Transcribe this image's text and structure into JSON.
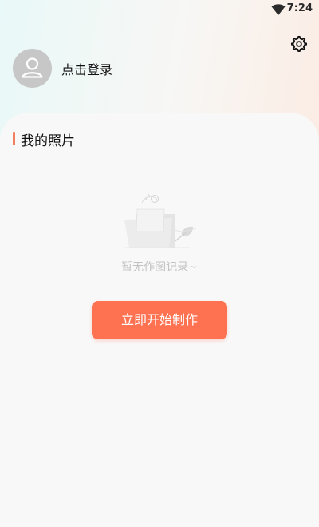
{
  "status_bar": {
    "time": "7:24",
    "wifi_icon": "wifi-icon"
  },
  "header": {
    "settings_icon": "gear-icon",
    "avatar_icon": "user-avatar-icon",
    "login_text": "点击登录"
  },
  "photos": {
    "section_title": "我的照片",
    "empty_icon": "empty-folder-icon",
    "empty_text": "暂无作图记录~",
    "start_button_label": "立即开始制作"
  },
  "colors": {
    "accent": "#fe7151",
    "section_bar": "#f0805f",
    "card_background": "#f8f8f8"
  }
}
